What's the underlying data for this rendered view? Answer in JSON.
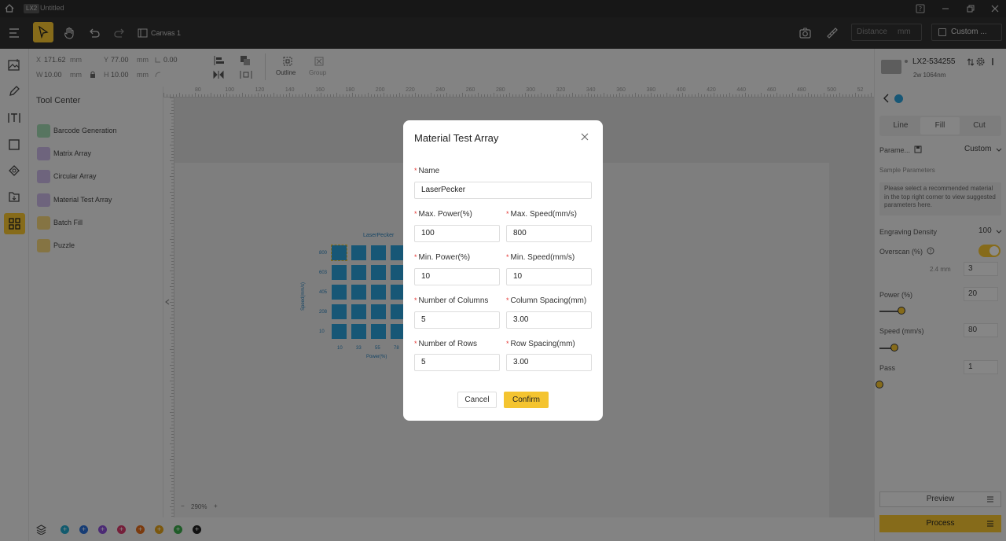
{
  "titlebar": {
    "badge": "LX2",
    "title": "Untitled"
  },
  "toolbar": {
    "canvas_label": "Canvas 1",
    "distance_placeholder": "Distance",
    "distance_unit": "mm",
    "custom_label": "Custom ..."
  },
  "props": {
    "x_label": "X",
    "x_value": "171.62",
    "y_label": "Y",
    "y_value": "77.00",
    "unit": "mm",
    "w_label": "W",
    "w_value": "10.00",
    "h_label": "H",
    "h_value": "10.00",
    "angle_value": "0.00",
    "outline_label": "Outline",
    "group_label": "Group"
  },
  "tool_center": {
    "header": "Tool Center",
    "items": [
      {
        "label": "Barcode Generation",
        "color": "#9ed6b0"
      },
      {
        "label": "Matrix Array",
        "color": "#c9b6e4"
      },
      {
        "label": "Circular Array",
        "color": "#c9b6e4"
      },
      {
        "label": "Material Test Array",
        "color": "#c9b6e4"
      },
      {
        "label": "Batch Fill",
        "color": "#f2d37a"
      },
      {
        "label": "Puzzle",
        "color": "#f2d37a"
      }
    ]
  },
  "ruler": {
    "top_ticks": [
      "80",
      "100",
      "120",
      "140",
      "160",
      "180",
      "200",
      "220",
      "240",
      "260",
      "280",
      "300",
      "320",
      "340",
      "360",
      "380",
      "400",
      "420",
      "440",
      "460",
      "480",
      "500",
      "52"
    ]
  },
  "preview": {
    "title": "LaserPecker",
    "y_axis": "Speed(mm/s)",
    "x_axis": "Power(%)",
    "y_ticks": [
      "800",
      "603",
      "405",
      "208",
      "10"
    ],
    "x_ticks": [
      "10",
      "33",
      "55",
      "78"
    ]
  },
  "zoom": {
    "value": "290%"
  },
  "bottom_colors": [
    "#22a6c8",
    "#2b6fd6",
    "#8a4fd6",
    "#d63a6a",
    "#e06a1a",
    "#e0a01a",
    "#3aa84a",
    "#222222"
  ],
  "right_panel": {
    "device_name": "LX2-534255",
    "device_spec": "2w 1064nm",
    "tabs": [
      "Line",
      "Fill",
      "Cut"
    ],
    "active_tab": 1,
    "param_label": "Parame...",
    "param_value": "Custom",
    "sample_label": "Sample Parameters",
    "sample_note": "Please select a recommended material in the top right corner to view suggested parameters here.",
    "density_label": "Engraving Density",
    "density_value": "100",
    "overscan_label": "Overscan (%)",
    "overscan_mm": "2.4 mm",
    "overscan_value": "3",
    "power_label": "Power (%)",
    "power_value": "20",
    "speed_label": "Speed (mm/s)",
    "speed_value": "80",
    "pass_label": "Pass",
    "pass_value": "1",
    "preview_btn": "Preview",
    "process_btn": "Process"
  },
  "modal": {
    "title": "Material Test Array",
    "name_label": "Name",
    "name_value": "LaserPecker",
    "max_power_label": "Max. Power(%)",
    "max_power_value": "100",
    "max_speed_label": "Max. Speed(mm/s)",
    "max_speed_value": "800",
    "min_power_label": "Min. Power(%)",
    "min_power_value": "10",
    "min_speed_label": "Min. Speed(mm/s)",
    "min_speed_value": "10",
    "cols_label": "Number of Columns",
    "cols_value": "5",
    "col_spacing_label": "Column Spacing(mm)",
    "col_spacing_value": "3.00",
    "rows_label": "Number of Rows",
    "rows_value": "5",
    "row_spacing_label": "Row Spacing(mm)",
    "row_spacing_value": "3.00",
    "cancel": "Cancel",
    "confirm": "Confirm"
  }
}
